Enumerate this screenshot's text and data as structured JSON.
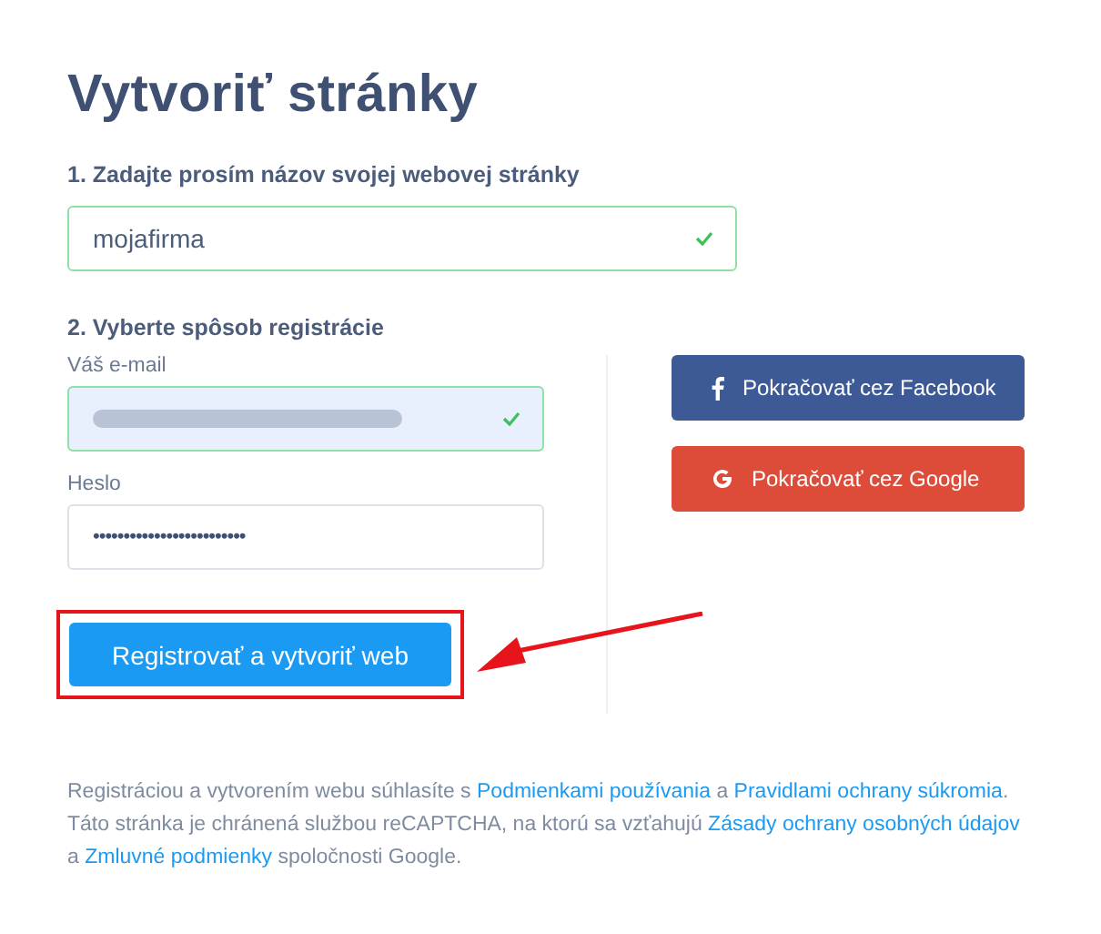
{
  "title": "Vytvoriť stránky",
  "step1": {
    "label": "1. Zadajte prosím názov svojej webovej stránky",
    "field": {
      "value": "mojafirma",
      "valid": true
    }
  },
  "step2": {
    "label": "2. Vyberte spôsob registrácie",
    "fields": [
      {
        "kind": "blurred",
        "label": "Váš e-mail",
        "valid": true,
        "autofilled": true
      },
      {
        "kind": "password",
        "label": "Heslo",
        "value": "•••••••••••••••••••••••••",
        "valid": false,
        "autofilled": false
      }
    ],
    "social": [
      {
        "kind": "facebook",
        "label": "Pokračovať cez Facebook"
      },
      {
        "kind": "google",
        "label": "Pokračovať cez Google"
      }
    ],
    "submit": {
      "label": "Registrovať a vytvoriť web",
      "highlighted": true
    }
  },
  "legal": [
    {
      "kind": "text",
      "text": "Registráciou a vytvorením webu súhlasíte s "
    },
    {
      "kind": "link",
      "text": "Podmienkami používania"
    },
    {
      "kind": "text",
      "text": " a "
    },
    {
      "kind": "link",
      "text": "Pravidlami ochrany súkromia"
    },
    {
      "kind": "text",
      "text": ". Táto stránka je chránená službou reCAPTCHA, na ktorú sa vzťahujú "
    },
    {
      "kind": "link",
      "text": "Zásady ochrany osobných údajov"
    },
    {
      "kind": "text",
      "text": " a "
    },
    {
      "kind": "link",
      "text": "Zmluvné podmienky"
    },
    {
      "kind": "text",
      "text": " spoločnosti Google."
    }
  ]
}
